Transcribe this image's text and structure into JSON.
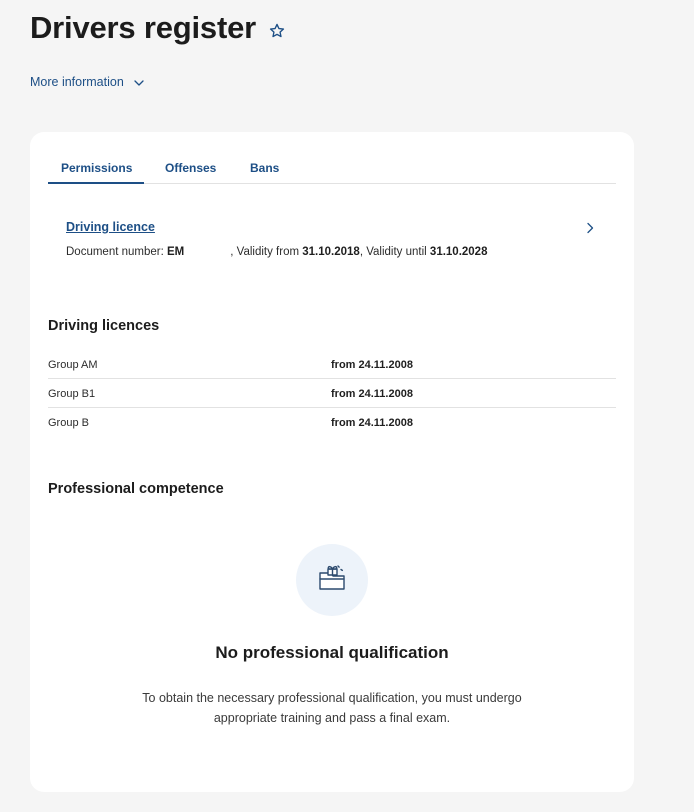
{
  "header": {
    "title": "Drivers register",
    "more_info": "More information"
  },
  "tabs": [
    {
      "label": "Permissions",
      "active": true
    },
    {
      "label": "Offenses",
      "active": false
    },
    {
      "label": "Bans",
      "active": false
    }
  ],
  "licence": {
    "link": "Driving licence",
    "doc_label": "Document number: ",
    "doc_number": "EM",
    "validity_from_label": ", Validity from ",
    "validity_from": "31.10.2018",
    "validity_until_label": ", Validity until ",
    "validity_until": "31.10.2028"
  },
  "driving_licences": {
    "heading": "Driving licences",
    "rows": [
      {
        "group": "Group AM",
        "date": "from 24.11.2008"
      },
      {
        "group": "Group B1",
        "date": "from 24.11.2008"
      },
      {
        "group": "Group B",
        "date": "from 24.11.2008"
      }
    ]
  },
  "competence": {
    "heading": "Professional competence",
    "empty_title": "No professional qualification",
    "empty_desc": "To obtain the necessary professional qualification, you must undergo appropriate training and pass a final exam."
  },
  "colors": {
    "accent": "#1d4f86",
    "background": "#f5f5f5",
    "card": "#ffffff",
    "illustration_bg": "#edf3fa"
  },
  "icons": [
    "star-icon",
    "chevron-down-icon",
    "chevron-right-icon",
    "folder-gift-icon"
  ]
}
